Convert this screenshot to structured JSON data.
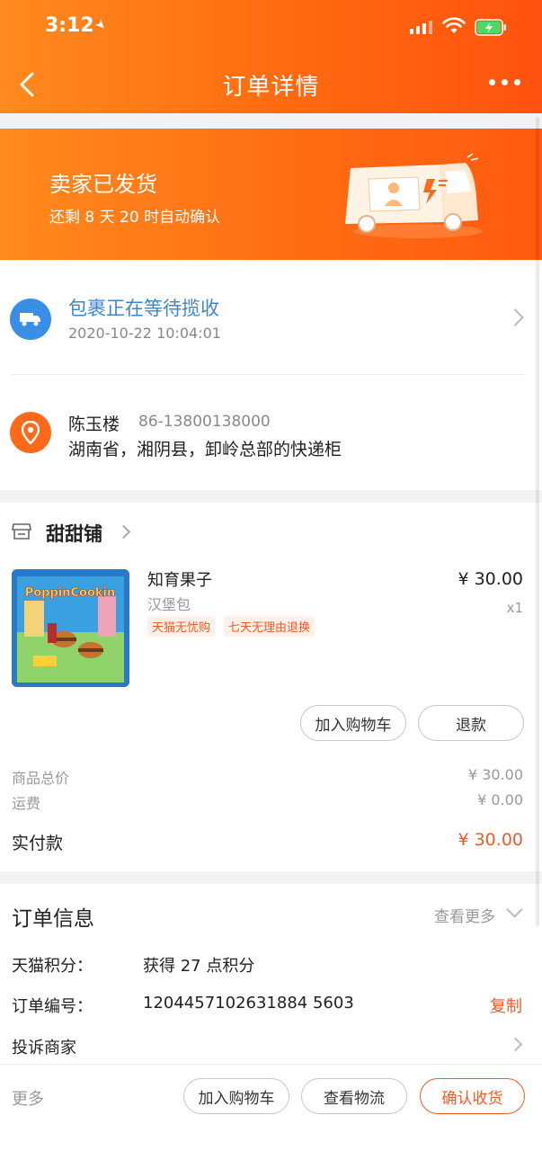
{
  "status_bar": {
    "time": "3:12"
  },
  "nav": {
    "title": "订单详情"
  },
  "banner": {
    "title": "卖家已发货",
    "subtitle": "还剩 8 天 20 时自动确认"
  },
  "logistics": {
    "status": "包裹正在等待揽收",
    "time": "2020-10-22 10:04:01"
  },
  "address": {
    "name": "陈玉楼",
    "phone": "86-13800138000",
    "line": "湖南省，湘阴县，卸岭总部的快递柜"
  },
  "shop": {
    "name": "甜甜铺",
    "product": {
      "name": "知育果子",
      "spec": "汉堡包",
      "tags": [
        "天猫无忧购",
        "七天无理由退换"
      ],
      "price": "¥ 30.00",
      "quantity": "x1",
      "image_text": "PoppinCookin"
    },
    "buttons": {
      "add_cart": "加入购物车",
      "refund": "退款"
    },
    "summary": {
      "goods_total_label": "商品总价",
      "goods_total": "¥ 30.00",
      "shipping_label": "运费",
      "shipping": "¥ 0.00",
      "paid_label": "实付款",
      "paid": "¥ 30.00"
    }
  },
  "order_info": {
    "title": "订单信息",
    "more": "查看更多",
    "points_label": "天猫积分：",
    "points_value": "获得 27 点积分",
    "order_no_label": "订单编号：",
    "order_no": "1204457102631884 5603",
    "copy": "复制",
    "complain": "投诉商家"
  },
  "bottom_bar": {
    "more": "更多",
    "add_cart": "加入购物车",
    "view_logistics": "查看物流",
    "confirm": "确认收货"
  },
  "colors": {
    "accent": "#f15a24",
    "header_orange": "#ff6a10",
    "link_blue": "#3f86c9"
  }
}
